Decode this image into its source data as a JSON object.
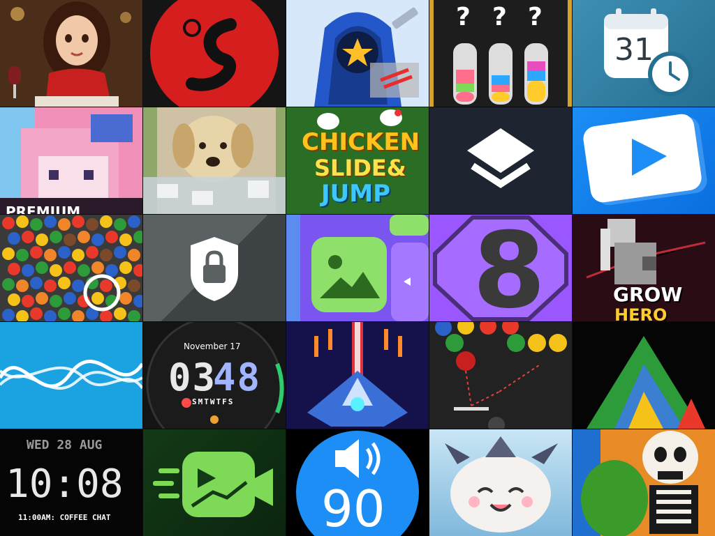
{
  "tiles": [
    {
      "id": "dinner-app"
    },
    {
      "id": "red-logo-app"
    },
    {
      "id": "hero-game"
    },
    {
      "id": "water-sort",
      "marks": [
        "?",
        "?",
        "?"
      ]
    },
    {
      "id": "calendar-app",
      "day": "31"
    },
    {
      "id": "pixel-art-app",
      "banner": "PREMIUM"
    },
    {
      "id": "puppy-puzzle"
    },
    {
      "id": "chicken-slide-jump",
      "line1": "CHICKEN",
      "line2": "SLIDE&",
      "line3": "JUMP"
    },
    {
      "id": "layers-app"
    },
    {
      "id": "video-player"
    },
    {
      "id": "candy-find"
    },
    {
      "id": "lock-app"
    },
    {
      "id": "gallery-app"
    },
    {
      "id": "eight-app",
      "digit": "8"
    },
    {
      "id": "grow-hero",
      "line1": "GROW",
      "line2": "HERO"
    },
    {
      "id": "wave-app"
    },
    {
      "id": "watch-face",
      "date": "November 17",
      "time_h": "03",
      "time_m": "48",
      "days": "SMTWTFS"
    },
    {
      "id": "space-shooter"
    },
    {
      "id": "ball-shooter"
    },
    {
      "id": "sand-pyramid"
    },
    {
      "id": "digital-clock",
      "date": "WED 28 AUG",
      "time": "10:08",
      "event": "11:00AM: COFFEE CHAT"
    },
    {
      "id": "video-maker"
    },
    {
      "id": "volume-app",
      "level": "90"
    },
    {
      "id": "fluffy-monster"
    },
    {
      "id": "skeleton-zombie"
    }
  ],
  "colors": {
    "red_accent": "#d61e1e",
    "blue_accent": "#1c8ef5",
    "purple_accent": "#9a57ff",
    "green_accent": "#7ed957"
  }
}
